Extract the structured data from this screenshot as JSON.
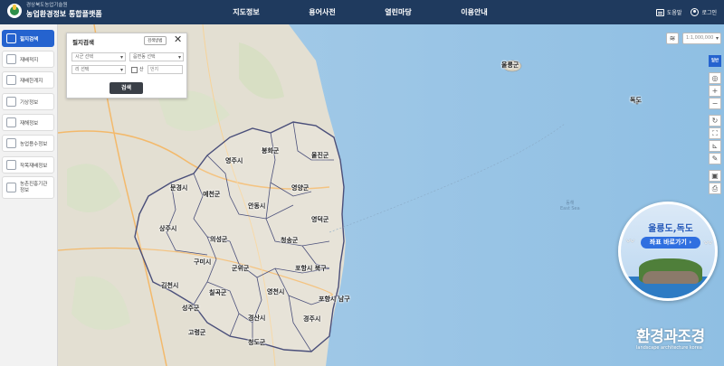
{
  "header": {
    "logo_sub": "경상북도농업기술원",
    "logo_main": "농업환경정보 통합플랫폼",
    "nav": [
      "지도정보",
      "용어사전",
      "열린마당",
      "이용안내"
    ],
    "help_label": "도움말",
    "login_label": "로그인"
  },
  "sidebar": {
    "items": [
      {
        "label": "필지검색",
        "active": true
      },
      {
        "label": "재배적지"
      },
      {
        "label": "재배한계지"
      },
      {
        "label": "기상정보"
      },
      {
        "label": "재해정보"
      },
      {
        "label": "농업용수정보"
      },
      {
        "label": "작목재배정보"
      },
      {
        "label": "농촌진흥기관 정보"
      }
    ]
  },
  "search_panel": {
    "title": "필지검색",
    "guide_label": "검색방법",
    "close_icon": "close-icon",
    "sigungu_placeholder": "시군 선택",
    "eupmyeondong_placeholder": "읍면동 선택",
    "ri_placeholder": "리 선택",
    "mountain_label": "산",
    "jibun_placeholder": "번지",
    "search_button": "검색"
  },
  "map_controls": {
    "scale_value": "1:1,000,000",
    "basemap_label": "일반",
    "layer_icon": "layers-icon",
    "tools": [
      "target-icon",
      "zoom-in-icon",
      "zoom-out-icon",
      "refresh-icon",
      "fullscreen-icon",
      "measure-icon",
      "draw-icon",
      "image-icon",
      "print-icon"
    ]
  },
  "map_labels": {
    "ulleungdo": "울릉군",
    "dokdo": "독도",
    "sea": "동해",
    "sea_en": "East Sea",
    "regions": [
      "봉화군",
      "울진군",
      "영주시",
      "문경시",
      "예천군",
      "영양군",
      "안동시",
      "상주시",
      "영덕군",
      "의성군",
      "청송군",
      "구미시",
      "군위군",
      "포항시 북구",
      "김천시",
      "칠곡군",
      "영천시",
      "포항시 남구",
      "성주군",
      "경산시",
      "경주시",
      "고령군",
      "청도군"
    ]
  },
  "promo": {
    "title": "울릉도,독도",
    "button": "좌표 바로가기 ›"
  },
  "brand": {
    "name": "환경과조경",
    "sub": "landscape architecture korea"
  },
  "colors": {
    "header_bg": "#1f3a5e",
    "accent": "#2563cf",
    "sea": "#9ec7e6",
    "boundary": "#4a4f7a"
  }
}
